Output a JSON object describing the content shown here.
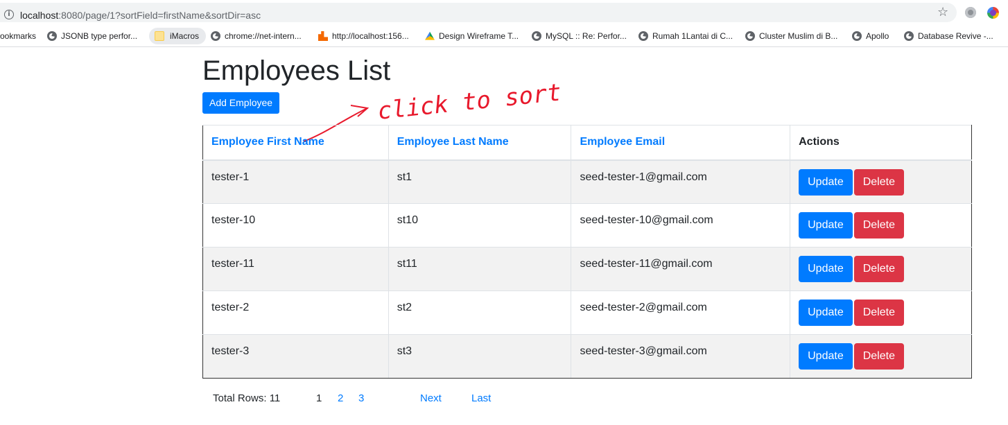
{
  "browser": {
    "url_host": "localhost",
    "url_rest": ":8080/page/1?sortField=firstName&sortDir=asc",
    "bookmarks": [
      {
        "label": "ookmarks",
        "icon": "none"
      },
      {
        "label": "JSONB type perfor...",
        "icon": "globe-icon"
      },
      {
        "label": "iMacros",
        "icon": "folder-icon"
      },
      {
        "label": "chrome://net-intern...",
        "icon": "globe-icon"
      },
      {
        "label": "http://localhost:156...",
        "icon": "grafana-icon"
      },
      {
        "label": "Design Wireframe T...",
        "icon": "drive-icon"
      },
      {
        "label": "MySQL :: Re: Perfor...",
        "icon": "globe-icon"
      },
      {
        "label": "Rumah 1Lantai di C...",
        "icon": "globe-icon"
      },
      {
        "label": "Cluster Muslim di B...",
        "icon": "globe-icon"
      },
      {
        "label": "Apollo",
        "icon": "globe-icon"
      },
      {
        "label": "Database Revive -...",
        "icon": "globe-icon"
      }
    ]
  },
  "page": {
    "title": "Employees List",
    "add_button": "Add Employee",
    "annotation_text": "click to sort",
    "annotation_color": "#e8192c"
  },
  "table": {
    "headers": {
      "first_name": "Employee First Name",
      "last_name": "Employee Last Name",
      "email": "Employee Email",
      "actions": "Actions"
    },
    "rows": [
      {
        "first": "tester-1",
        "last": "st1",
        "email": "seed-tester-1@gmail.com"
      },
      {
        "first": "tester-10",
        "last": "st10",
        "email": "seed-tester-10@gmail.com"
      },
      {
        "first": "tester-11",
        "last": "st11",
        "email": "seed-tester-11@gmail.com"
      },
      {
        "first": "tester-2",
        "last": "st2",
        "email": "seed-tester-2@gmail.com"
      },
      {
        "first": "tester-3",
        "last": "st3",
        "email": "seed-tester-3@gmail.com"
      }
    ],
    "update_label": "Update",
    "delete_label": "Delete"
  },
  "pagination": {
    "total_rows": "Total Rows: 11",
    "current_page": "1",
    "page_2": "2",
    "page_3": "3",
    "next": "Next",
    "last": "Last"
  },
  "colors": {
    "primary": "#007bff",
    "danger": "#dc3545",
    "stripe": "#f2f2f2"
  }
}
